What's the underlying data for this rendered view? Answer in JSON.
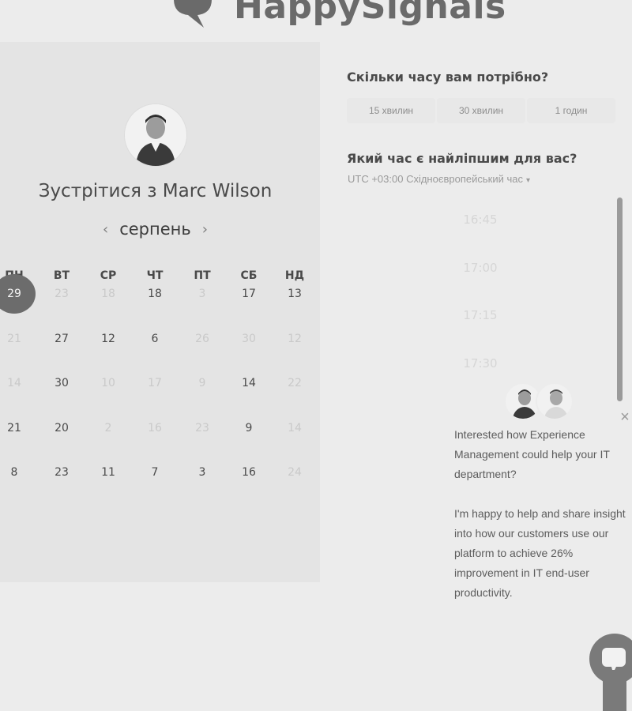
{
  "brand": {
    "name": "HappySignals"
  },
  "calendar": {
    "title": "Зустрітися з Marc Wilson",
    "month": "серпень",
    "prev_icon": "‹",
    "next_icon": "›",
    "weekdays": [
      "ПН",
      "ВТ",
      "СР",
      "ЧТ",
      "ПТ",
      "СБ",
      "НД"
    ],
    "rows": [
      [
        "29",
        "23",
        "18",
        "18",
        "3",
        "17",
        "13"
      ],
      [
        "21",
        "27",
        "12",
        "6",
        "26",
        "30",
        "12"
      ],
      [
        "14",
        "30",
        "10",
        "17",
        "9",
        "14",
        "22"
      ],
      [
        "21",
        "20",
        "2",
        "16",
        "23",
        "9",
        "14"
      ],
      [
        "8",
        "23",
        "11",
        "7",
        "3",
        "16",
        "24"
      ]
    ],
    "muted": [
      [
        false,
        true,
        true,
        false,
        true,
        false,
        false
      ],
      [
        true,
        false,
        false,
        false,
        true,
        true,
        true
      ],
      [
        true,
        false,
        true,
        true,
        true,
        false,
        true
      ],
      [
        false,
        false,
        true,
        true,
        true,
        false,
        true
      ],
      [
        false,
        false,
        false,
        false,
        false,
        false,
        true
      ]
    ],
    "selected": {
      "row": 0,
      "col": 0
    }
  },
  "duration": {
    "question": "Скільки часу вам потрібно?",
    "options": [
      "15 хвилин",
      "30 хвилин",
      "1 годин"
    ]
  },
  "time": {
    "question": "Який час є найліпшим для вас?",
    "timezone": "UTC +03:00 Східноєвропейський час",
    "caret": "▾",
    "slots": [
      "16:45",
      "17:00",
      "17:15",
      "17:30"
    ]
  },
  "chat": {
    "close_icon": "×",
    "message_1": "Interested how Experience Management could help your IT department?",
    "message_2": "I'm happy to help and share insight into how our customers use our platform to achieve 26% improvement in IT end-user productivity."
  },
  "colors": {
    "selected_day": "#6c6c6c",
    "card_bg": "#e4e4e4",
    "page_bg": "#ececec"
  }
}
